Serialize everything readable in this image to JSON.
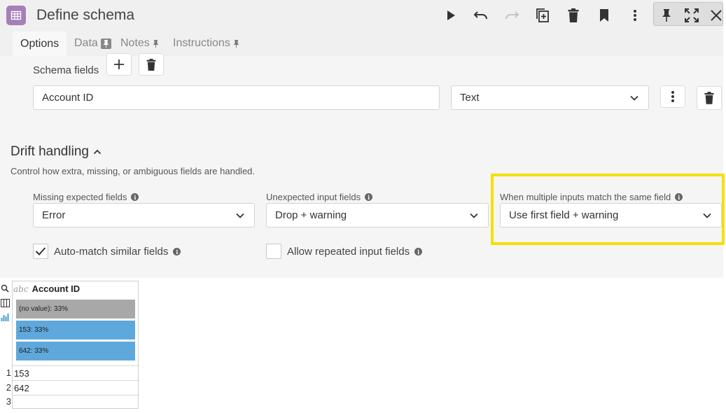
{
  "app": {
    "title": "Define schema"
  },
  "toolbar": {
    "icons": [
      "play-icon",
      "undo-icon",
      "redo-icon",
      "duplicate-icon",
      "delete-icon",
      "bookmark-icon",
      "more-vertical-icon",
      "pin-icon",
      "expand-icon",
      "close-icon"
    ]
  },
  "tabs": [
    {
      "label": "Options",
      "active": true
    },
    {
      "label": "Data",
      "active": false
    },
    {
      "label": "Notes",
      "active": false
    },
    {
      "label": "Instructions",
      "active": false
    }
  ],
  "schema": {
    "label": "Schema fields",
    "field_value": "Account ID",
    "type_value": "Text"
  },
  "drift": {
    "title": "Drift handling",
    "description": "Control how extra, missing, or ambiguous fields are handled.",
    "missing": {
      "label": "Missing expected fields",
      "value": "Error"
    },
    "unexpected": {
      "label": "Unexpected input fields",
      "value": "Drop + warning"
    },
    "multiple": {
      "label": "When multiple inputs match the same field",
      "value": "Use first field + warning"
    },
    "auto_match": {
      "label": "Auto-match similar fields",
      "checked": true
    },
    "allow_repeated": {
      "label": "Allow repeated input fields",
      "checked": false
    }
  },
  "colors": {
    "highlight": "#f5e000",
    "bar_blue": "#5ea8dc",
    "bar_gray": "#a8a8a8",
    "app_icon": "#a57fb8"
  },
  "preview": {
    "column_type": "abc",
    "column_name": "Account ID",
    "bars": [
      {
        "label": "(no value): 33%",
        "color": "#a8a8a8"
      },
      {
        "label": "153: 33%",
        "color": "#5ea8dc"
      },
      {
        "label": "642: 33%",
        "color": "#5ea8dc"
      }
    ],
    "rows": [
      {
        "num": "1",
        "value": "153"
      },
      {
        "num": "2",
        "value": "642"
      },
      {
        "num": "3",
        "value": ""
      }
    ]
  }
}
